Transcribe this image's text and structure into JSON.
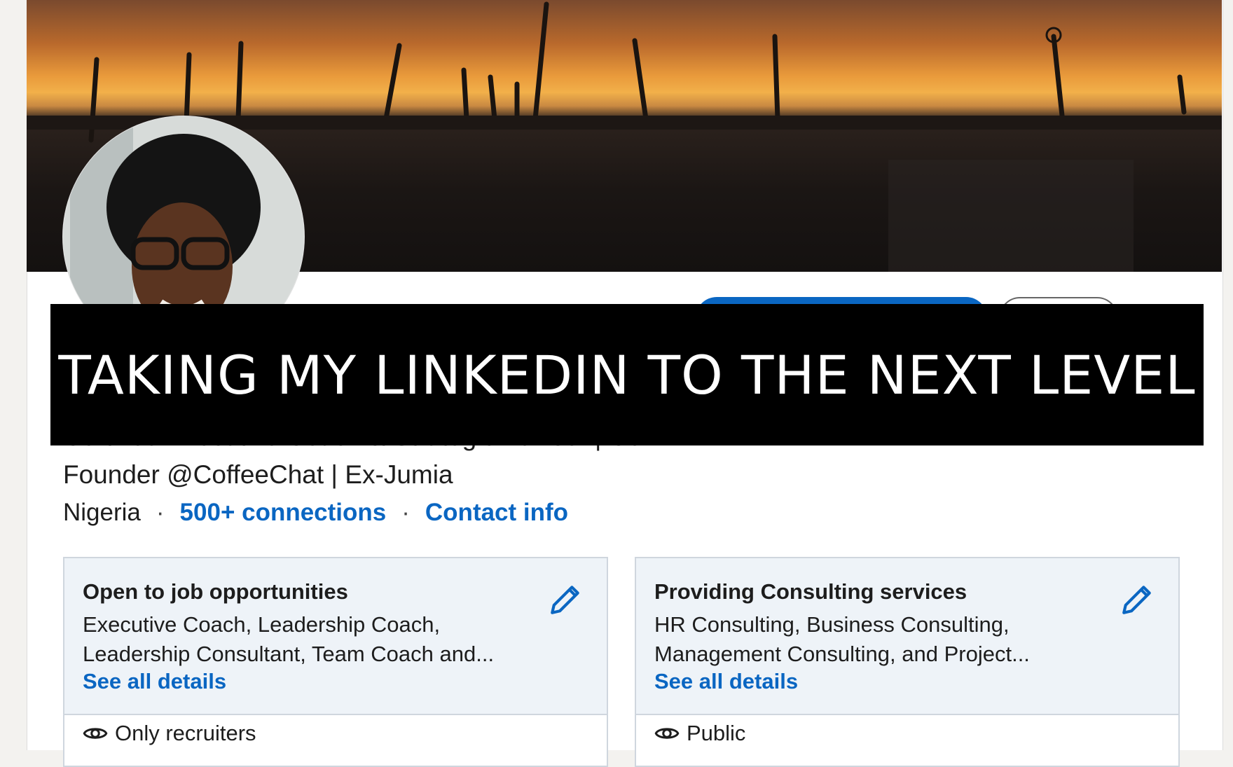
{
  "overlay": {
    "title": "TAKING MY LINKEDIN TO THE NEXT LEVEL"
  },
  "profile": {
    "headline_line1": "Certified Executive Coach & Strategic Advisor | Co-",
    "headline_line2": "Founder @CoffeeChat | Ex-Jumia",
    "location": "Nigeria",
    "connections": "500+ connections",
    "contact": "Contact info"
  },
  "cards": [
    {
      "title": "Open to job opportunities",
      "line1": "Executive Coach, Leadership Coach,",
      "line2": "Leadership Consultant, Team Coach and...",
      "link": "See all details",
      "visibility": "Only recruiters",
      "edit_icon": "pencil-icon",
      "visibility_icon": "eye-icon"
    },
    {
      "title": "Providing Consulting services",
      "line1": "HR Consulting, Business Consulting,",
      "line2": "Management Consulting, and Project...",
      "link": "See all details",
      "visibility": "Public",
      "edit_icon": "pencil-icon",
      "visibility_icon": "eye-icon"
    }
  ],
  "colors": {
    "accent": "#0a66c2",
    "panel_bg": "#eef3f8"
  }
}
